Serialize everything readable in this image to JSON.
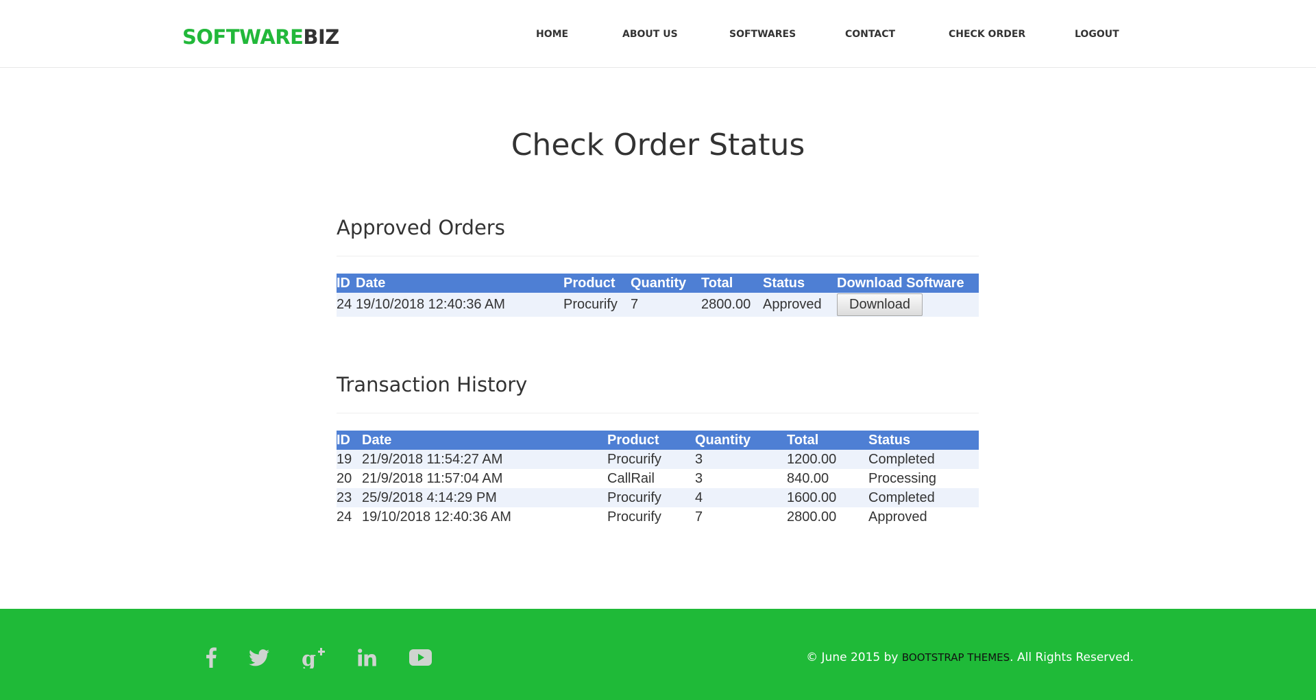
{
  "brand": {
    "part1": "SOFTWARE",
    "part2": "BIZ",
    "accent_color": "#22b83a"
  },
  "nav": {
    "items": [
      {
        "label": "HOME"
      },
      {
        "label": "ABOUT US"
      },
      {
        "label": "SOFTWARES"
      },
      {
        "label": "CONTACT"
      },
      {
        "label": "CHECK ORDER"
      },
      {
        "label": "LOGOUT"
      }
    ]
  },
  "page": {
    "title": "Check Order Status"
  },
  "approved": {
    "heading": "Approved Orders",
    "columns": [
      "ID",
      "Date",
      "Product",
      "Quantity",
      "Total",
      "Status",
      "Download Software"
    ],
    "rows": [
      {
        "id": "24",
        "date": "19/10/2018 12:40:36 AM",
        "product": "Procurify",
        "quantity": "7",
        "total": "2800.00",
        "status": "Approved",
        "action": "Download"
      }
    ]
  },
  "history": {
    "heading": "Transaction History",
    "columns": [
      "ID",
      "Date",
      "Product",
      "Quantity",
      "Total",
      "Status"
    ],
    "rows": [
      {
        "id": "19",
        "date": "21/9/2018 11:54:27 AM",
        "product": "Procurify",
        "quantity": "3",
        "total": "1200.00",
        "status": "Completed"
      },
      {
        "id": "20",
        "date": "21/9/2018 11:57:04 AM",
        "product": "CallRail",
        "quantity": "3",
        "total": "840.00",
        "status": "Processing"
      },
      {
        "id": "23",
        "date": "25/9/2018 4:14:29 PM",
        "product": "Procurify",
        "quantity": "4",
        "total": "1600.00",
        "status": "Completed"
      },
      {
        "id": "24",
        "date": "19/10/2018 12:40:36 AM",
        "product": "Procurify",
        "quantity": "7",
        "total": "2800.00",
        "status": "Approved"
      }
    ]
  },
  "footer": {
    "social_icons": [
      "facebook-icon",
      "twitter-icon",
      "google-plus-icon",
      "linkedin-icon",
      "youtube-icon"
    ],
    "copyright_prefix": "© June 2015 by ",
    "copyright_link": "BOOTSTRAP THEMES",
    "copyright_suffix": ". All Rights Reserved.",
    "background_color": "#1fba38"
  },
  "colors": {
    "table_header": "#4e7fd4",
    "row_stripe": "#edf2fb"
  }
}
